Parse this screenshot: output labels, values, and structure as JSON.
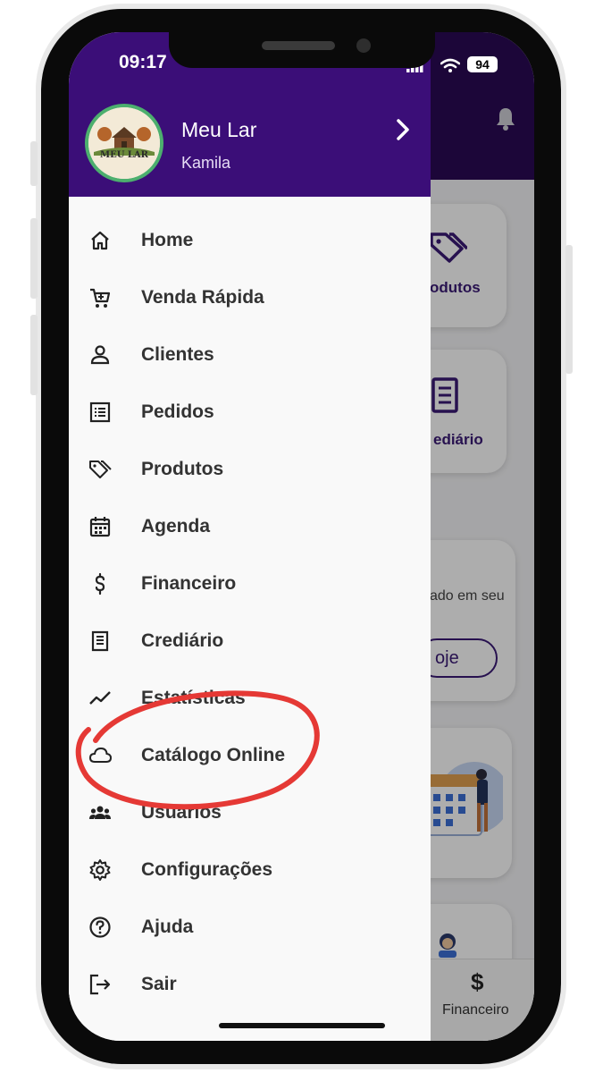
{
  "status": {
    "time": "09:17",
    "battery": "94"
  },
  "drawer": {
    "store_name": "Meu Lar",
    "user_name": "Kamila",
    "logo_text": "MEU LAR",
    "menu": [
      {
        "label": "Home",
        "icon": "home-icon"
      },
      {
        "label": "Venda Rápida",
        "icon": "cart-icon"
      },
      {
        "label": "Clientes",
        "icon": "person-icon"
      },
      {
        "label": "Pedidos",
        "icon": "list-icon"
      },
      {
        "label": "Produtos",
        "icon": "tags-icon"
      },
      {
        "label": "Agenda",
        "icon": "calendar-icon"
      },
      {
        "label": "Financeiro",
        "icon": "dollar-icon"
      },
      {
        "label": "Crediário",
        "icon": "receipt-icon"
      },
      {
        "label": "Estatísticas",
        "icon": "trend-icon"
      },
      {
        "label": "Catálogo Online",
        "icon": "cloud-icon"
      },
      {
        "label": "Usuários",
        "icon": "users-icon"
      },
      {
        "label": "Configurações",
        "icon": "gear-icon"
      },
      {
        "label": "Ajuda",
        "icon": "help-icon"
      },
      {
        "label": "Sair",
        "icon": "logout-icon"
      }
    ]
  },
  "background_app": {
    "card_produtos": "odutos",
    "card_crediario": "ediário",
    "promo_text": "ado em seu",
    "promo_button": "oje",
    "tab_financeiro": "Financeiro",
    "tab_financeiro_icon": "$"
  },
  "colors": {
    "drawer_header": "#3b0e78",
    "app_header": "#2a0a55",
    "annotation_circle": "#e53935",
    "avatar_ring": "#4caf6e"
  }
}
